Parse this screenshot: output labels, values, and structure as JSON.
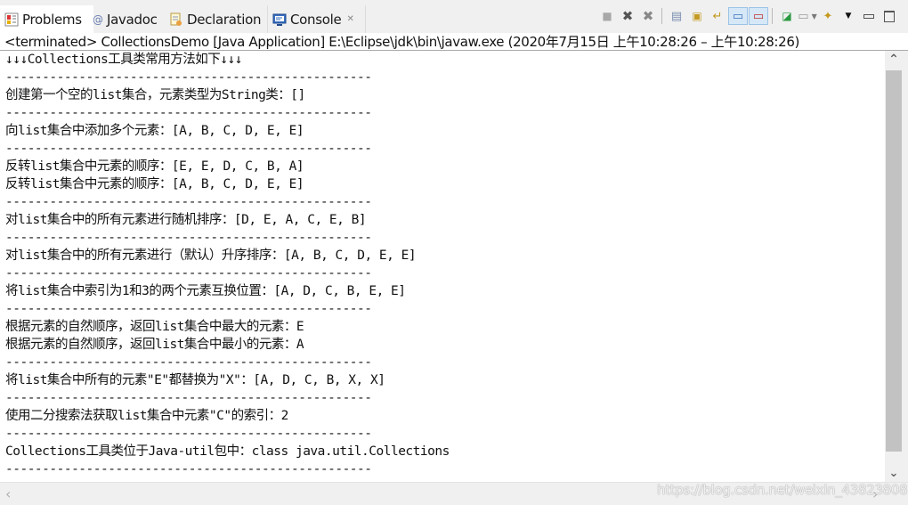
{
  "tabs": [
    {
      "label": "Problems",
      "icon": "problems-icon",
      "active": false
    },
    {
      "label": "Javadoc",
      "icon": "javadoc-icon",
      "active": false
    },
    {
      "label": "Declaration",
      "icon": "declaration-icon",
      "active": false
    },
    {
      "label": "Console",
      "icon": "console-icon",
      "active": true,
      "close": "✕"
    }
  ],
  "toolbar": {
    "buttons": [
      {
        "name": "terminate-button",
        "icon": "stop-icon",
        "glyph": "■"
      },
      {
        "name": "remove-launch-button",
        "icon": "remove-icon",
        "glyph": "✖"
      },
      {
        "name": "remove-all-terminated-button",
        "icon": "remove-all-icon",
        "glyph": "✖"
      },
      {
        "name": "clear-console-button",
        "icon": "clear-console-icon",
        "glyph": "▤"
      },
      {
        "name": "scroll-lock-button",
        "icon": "scroll-lock-icon",
        "glyph": "🔒"
      },
      {
        "name": "word-wrap-button",
        "icon": "word-wrap-icon",
        "glyph": "↵"
      },
      {
        "name": "show-on-stdout-button",
        "icon": "show-stdout-icon",
        "glyph": "▭"
      },
      {
        "name": "show-on-stderr-button",
        "icon": "show-stderr-icon",
        "glyph": "▭"
      },
      {
        "name": "pin-console-button",
        "icon": "pin-icon",
        "glyph": "📌"
      },
      {
        "name": "display-console-button",
        "icon": "display-console-icon",
        "glyph": "▭"
      },
      {
        "name": "open-console-button",
        "icon": "open-console-icon",
        "glyph": "✦"
      },
      {
        "name": "view-menu-button",
        "icon": "chevron-down-icon",
        "glyph": "▼"
      },
      {
        "name": "minimize-button",
        "icon": "minimize-icon",
        "glyph": "▭"
      },
      {
        "name": "maximize-button",
        "icon": "maximize-icon",
        "glyph": "☐"
      }
    ]
  },
  "status": "<terminated> CollectionsDemo [Java Application] E:\\Eclipse\\jdk\\bin\\javaw.exe  (2020年7月15日 上午10:28:26 – 上午10:28:26)",
  "console_lines": [
    "↓↓↓Collections工具类常用方法如下↓↓↓",
    "--------------------------------------------------",
    "创建第一个空的list集合，元素类型为String类：[]",
    "--------------------------------------------------",
    "向list集合中添加多个元素：[A, B, C, D, E, E]",
    "--------------------------------------------------",
    "反转list集合中元素的顺序：[E, E, D, C, B, A]",
    "反转list集合中元素的顺序：[A, B, C, D, E, E]",
    "--------------------------------------------------",
    "对list集合中的所有元素进行随机排序：[D, E, A, C, E, B]",
    "--------------------------------------------------",
    "对list集合中的所有元素进行（默认）升序排序：[A, B, C, D, E, E]",
    "--------------------------------------------------",
    "将list集合中索引为1和3的两个元素互换位置：[A, D, C, B, E, E]",
    "--------------------------------------------------",
    "根据元素的自然顺序，返回list集合中最大的元素：E",
    "根据元素的自然顺序，返回list集合中最小的元素：A",
    "--------------------------------------------------",
    "将list集合中所有的元素\"E\"都替换为\"X\"：[A, D, C, B, X, X]",
    "--------------------------------------------------",
    "使用二分搜索法获取list集合中元素\"C\"的索引：2",
    "--------------------------------------------------",
    "Collections工具类位于Java-util包中：class java.util.Collections",
    "--------------------------------------------------"
  ],
  "scroll": {
    "up": "⌃",
    "down": "⌄",
    "left": "‹",
    "right": "›"
  },
  "watermark": "https://blog.csdn.net/weixin_43823808"
}
